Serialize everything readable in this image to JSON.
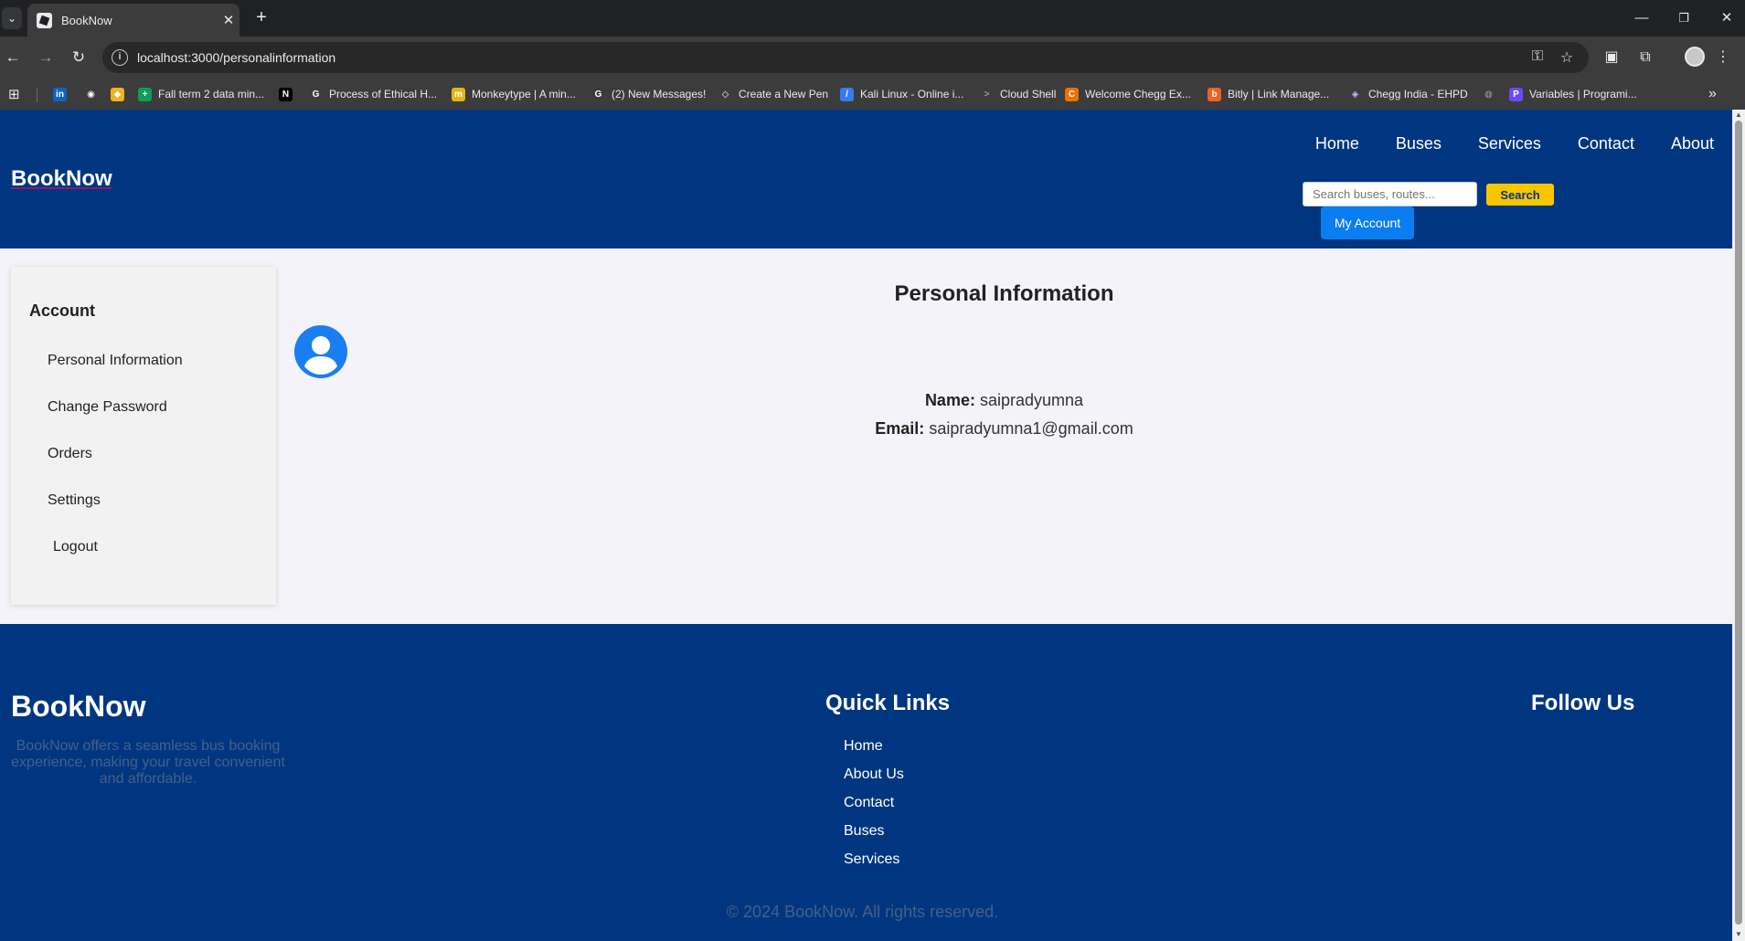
{
  "browser": {
    "tab_title": "BookNow",
    "url": "localhost:3000/personalinformation",
    "bookmarks": [
      {
        "label": "",
        "icon": "linkedin-icon",
        "color": "#0a66c2"
      },
      {
        "label": "",
        "icon": "github-icon",
        "color": "#ffffff"
      },
      {
        "label": "",
        "icon": "bookmark-icon",
        "color": "#f2b01e"
      },
      {
        "label": "Fall term 2 data min...",
        "icon": "sheets-icon",
        "color": "#0f9d58"
      },
      {
        "label": "",
        "icon": "notion-icon",
        "color": "#000000"
      },
      {
        "label": "Process of Ethical H...",
        "icon": "google-icon",
        "color": "#ffffff"
      },
      {
        "label": "Monkeytype | A min...",
        "icon": "monkeytype-icon",
        "color": "#e2b714"
      },
      {
        "label": "(2) New Messages!",
        "icon": "google-icon",
        "color": "#ffffff"
      },
      {
        "label": "Create a New Pen",
        "icon": "codepen-icon",
        "color": "#ffffff"
      },
      {
        "label": "Kali Linux - Online i...",
        "icon": "kali-icon",
        "color": "#367bf0"
      },
      {
        "label": "Cloud Shell",
        "icon": "terminal-icon",
        "color": "#9aa0a6"
      },
      {
        "label": "Welcome Chegg Ex...",
        "icon": "chegg-icon",
        "color": "#eb7100"
      },
      {
        "label": "Bitly | Link Manage...",
        "icon": "bitly-icon",
        "color": "#ee6123"
      },
      {
        "label": "Chegg India - EHPD",
        "icon": "diamond-icon",
        "color": "#c0c0ff"
      },
      {
        "label": "",
        "icon": "globe-icon",
        "color": "#9aa0a6"
      },
      {
        "label": "Variables | Programi...",
        "icon": "programiz-icon",
        "color": "#6c47ff"
      }
    ]
  },
  "header": {
    "brand": "BookNow",
    "nav": [
      "Home",
      "Buses",
      "Services",
      "Contact",
      "About"
    ],
    "search_placeholder": "Search buses, routes...",
    "search_label": "Search",
    "account_label": "My Account"
  },
  "sidebar": {
    "title": "Account",
    "items": [
      "Personal Information",
      "Change Password",
      "Orders",
      "Settings",
      "Logout"
    ]
  },
  "profile": {
    "title": "Personal Information",
    "name_label": "Name:",
    "name_value": "saipradyumna",
    "email_label": "Email:",
    "email_value": "saipradyumna1@gmail.com"
  },
  "footer": {
    "brand": "BookNow",
    "description": "BookNow offers a seamless bus booking experience, making your travel convenient and affordable.",
    "quick_links_title": "Quick Links",
    "quick_links": [
      "Home",
      "About Us",
      "Contact",
      "Buses",
      "Services"
    ],
    "follow_title": "Follow Us",
    "copyright": "© 2024 BookNow. All rights reserved."
  },
  "colors": {
    "header_bg": "#00367f",
    "search_button": "#f7c600",
    "account_button": "#0a7df0",
    "page_bg": "#f4f3f9"
  }
}
